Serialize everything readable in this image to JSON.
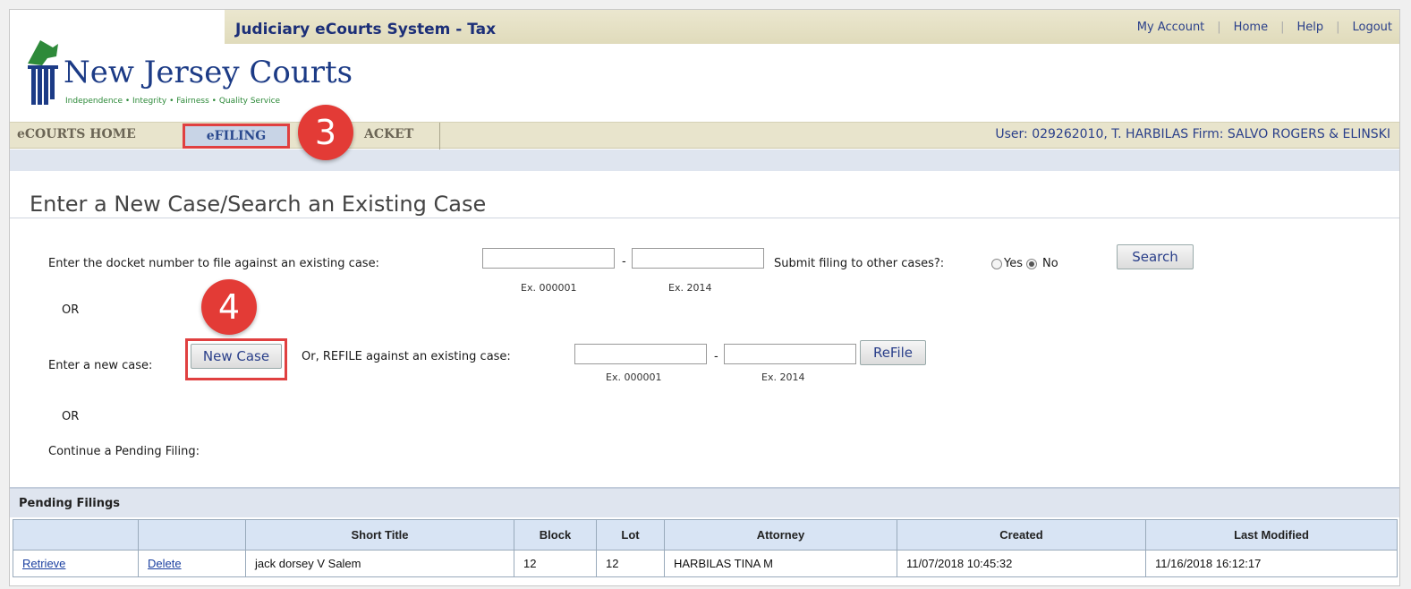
{
  "header": {
    "system_title": "Judiciary eCourts System - Tax",
    "links": [
      "My Account",
      "Home",
      "Help",
      "Logout"
    ],
    "logo_text": "New Jersey Courts",
    "logo_tagline": "Independence • Integrity • Fairness • Quality Service"
  },
  "nav": {
    "tabs": [
      "eCOURTS HOME",
      "eFILING",
      "DOCKET"
    ],
    "docket_visible": "ACKET",
    "user_info": "User: 029262010, T. HARBILAS  Firm: SALVO ROGERS & ELINSKI"
  },
  "annotations": {
    "step3": "3",
    "step4": "4"
  },
  "page": {
    "title": "Enter a New Case/Search an Existing Case"
  },
  "search": {
    "label": "Enter the docket number to file against an existing case:",
    "dash": "-",
    "hint1": "Ex. 000001",
    "hint2": "Ex. 2014",
    "submit_other_label": "Submit filing to other cases?:",
    "yes_label": "Yes",
    "no_label": "No",
    "search_button": "Search"
  },
  "or1": "OR",
  "new_case": {
    "label": "Enter a new case:",
    "button": "New Case",
    "refile_label": "Or, REFILE against an existing case:",
    "dash": "-",
    "hint1": "Ex. 000001",
    "hint2": "Ex. 2014",
    "refile_button": "ReFile"
  },
  "or2": "OR",
  "continue_label": "Continue a Pending Filing:",
  "pending": {
    "header": "Pending Filings",
    "columns": [
      "",
      "",
      "Short Title",
      "Block",
      "Lot",
      "Attorney",
      "Created",
      "Last Modified"
    ],
    "rows": [
      {
        "retrieve": "Retrieve",
        "delete": "Delete",
        "short_title": "jack dorsey V Salem",
        "block": "12",
        "lot": "12",
        "attorney": "HARBILAS TINA M",
        "created": "11/07/2018 10:45:32",
        "last_modified": "11/16/2018 16:12:17"
      }
    ]
  },
  "colors": {
    "accent_red": "#e33b36",
    "nav_bg": "#e8e4cc",
    "band_blue": "#dfe5ef",
    "link_blue": "#2a3f8a"
  }
}
